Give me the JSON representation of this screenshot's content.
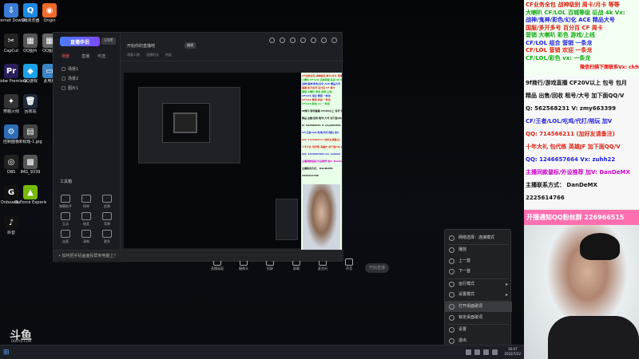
{
  "desktop": {
    "icons": [
      {
        "label": "Internet Downlo...",
        "glyph": "⇩",
        "color": "#3a7bd5"
      },
      {
        "label": "QQ浏览器",
        "glyph": "Q",
        "color": "#1e88e5"
      },
      {
        "label": "Origin",
        "glyph": "◉",
        "color": "#f06a2a"
      },
      {
        "label": "CapCut",
        "glyph": "✂",
        "color": "#222"
      },
      {
        "label": "QQ图片",
        "glyph": "▦",
        "color": "#555"
      },
      {
        "label": "QQ图片",
        "glyph": "▦",
        "color": "#666"
      },
      {
        "label": "Adobe Premiere",
        "glyph": "Pr",
        "color": "#2a1e5c"
      },
      {
        "label": "QQ游戏",
        "glyph": "◆",
        "color": "#1aa3e8"
      },
      {
        "label": "此电脑",
        "glyph": "▭",
        "color": "#3b82c4"
      },
      {
        "label": "穿越火线",
        "glyph": "✦",
        "color": "#333"
      },
      {
        "label": "回收站",
        "glyph": "🗑",
        "color": "#1f2a3a"
      },
      {
        "label": "新建文件",
        "glyph": "▣",
        "color": "#d6a23a"
      },
      {
        "label": "控制面板",
        "glyph": "⚙",
        "color": "#2d6db5"
      },
      {
        "label": "未标题-1.jpg",
        "glyph": "▤",
        "color": "#444"
      },
      {
        "label": "新建文件夹",
        "glyph": "▣",
        "color": "#e0b040"
      },
      {
        "label": "OBS",
        "glyph": "◎",
        "color": "#222"
      },
      {
        "label": "IMG_9339",
        "glyph": "▩",
        "color": "#555"
      },
      {
        "label": "新建文本文档.txt",
        "glyph": "≣",
        "color": "#888"
      },
      {
        "label": "Onboard...",
        "glyph": "G",
        "color": "#111"
      },
      {
        "label": "GeForce Experience",
        "glyph": "▲",
        "color": "#76b900"
      },
      {
        "label": "QQ",
        "glyph": "♣",
        "color": "#111"
      },
      {
        "label": "抖音",
        "glyph": "♪",
        "color": "#111"
      }
    ]
  },
  "app": {
    "logo": "直播伴侣",
    "badge": "LIVE",
    "tabs": [
      "场景",
      "直播",
      "可选"
    ],
    "scenes": [
      "场景1",
      "场景2",
      "图片1"
    ],
    "tools_title": "工具箱",
    "tools": [
      "弹幕助手",
      "榜单",
      "投票",
      "互动",
      "抽奖",
      "背景",
      "连麦",
      "录制",
      "更多"
    ],
    "title": "开始你的直播吧",
    "chip": "编辑",
    "meta": [
      "观看人数",
      "直播时长",
      "热度"
    ],
    "controls": [
      "直播画面",
      "摄像头",
      "投屏",
      "屏幕",
      "麦克风",
      "声音"
    ],
    "go_live": "开始直播",
    "tip": "• 如何把手机画面投屏到电脑上？"
  },
  "context_menu": {
    "items": [
      {
        "label": "网络选择：连接模式",
        "arrow": false,
        "highlight": false
      },
      {
        "label": "播放",
        "arrow": false,
        "highlight": false
      },
      {
        "label": "上一首",
        "arrow": false,
        "highlight": false
      },
      {
        "label": "下一首",
        "arrow": false,
        "highlight": false
      },
      {
        "label": "运行模式",
        "arrow": true,
        "highlight": false
      },
      {
        "label": "设置模式",
        "arrow": true,
        "highlight": false
      },
      {
        "label": "打开桌面歌词",
        "arrow": false,
        "highlight": true
      },
      {
        "label": "锁定桌面歌词",
        "arrow": false,
        "highlight": false
      },
      {
        "label": "设置",
        "arrow": false,
        "highlight": false
      },
      {
        "label": "退出",
        "arrow": false,
        "highlight": false
      }
    ]
  },
  "overlay": {
    "top_lines": [
      {
        "text": "CF业务全包 战神级别 周卡/月卡 等等",
        "color": "#d21"
      },
      {
        "text": "大喇叭 CF/LOL 百城等级 征战 4k Vx:",
        "color": "#1a1"
      },
      {
        "text": "战神/鬼神/彩色/幻化 ACE 精品大号",
        "color": "#22d"
      },
      {
        "text": "国服/多开多号 百分百 CF 周卡",
        "color": "#d21"
      },
      {
        "text": "营销 大喇叭 彩色 游戏/上线",
        "color": "#1a1"
      },
      {
        "text": "CF/LOL 组合 营销 一条龙",
        "color": "#22d"
      },
      {
        "text": "CF/LOL 营销 欢迎 一条龙",
        "color": "#d21"
      },
      {
        "text": "CF/LOL/彩色 vx: 一条龙",
        "color": "#1a1"
      }
    ],
    "promo": "微信扫描下面联系Vx: ch90001",
    "mid_lines": [
      {
        "text": "9f商行/游戏直播 CF20V以上 包号 包月",
        "color": "#111"
      },
      {
        "text": "精品 出售/回收 租号/大号 加下面QQ/V",
        "color": "#111"
      },
      {
        "text": "Q: 562568231  V: zmy663399",
        "color": "#111"
      },
      {
        "text": "CF/王者/LOL/吃鸡/代打/陪玩 加V",
        "color": "#22d"
      },
      {
        "text": "QQ: 714566211 (加好友请备注)",
        "color": "#d21"
      },
      {
        "text": "十年大礼 包代练 英雄JF 加下面QQ/V",
        "color": "#d21"
      },
      {
        "text": "QQ: 1246657664  Vx: zuhh22",
        "color": "#22d"
      },
      {
        "text": "主播同款鼠标/外设推荐 加V: DanDeMX",
        "color": "#c0c"
      },
      {
        "text": "主播联系方式： DanDeMX",
        "color": "#111"
      },
      {
        "text": "2225614766",
        "color": "#111"
      }
    ],
    "qq_bar": "开播通知QQ粉丝群 226966515"
  },
  "watermark": {
    "logo": "斗鱼",
    "sub": "DOUYU.COM"
  },
  "taskbar": {
    "start": "⊞",
    "time": "16:47",
    "date": "2022/7/22"
  }
}
